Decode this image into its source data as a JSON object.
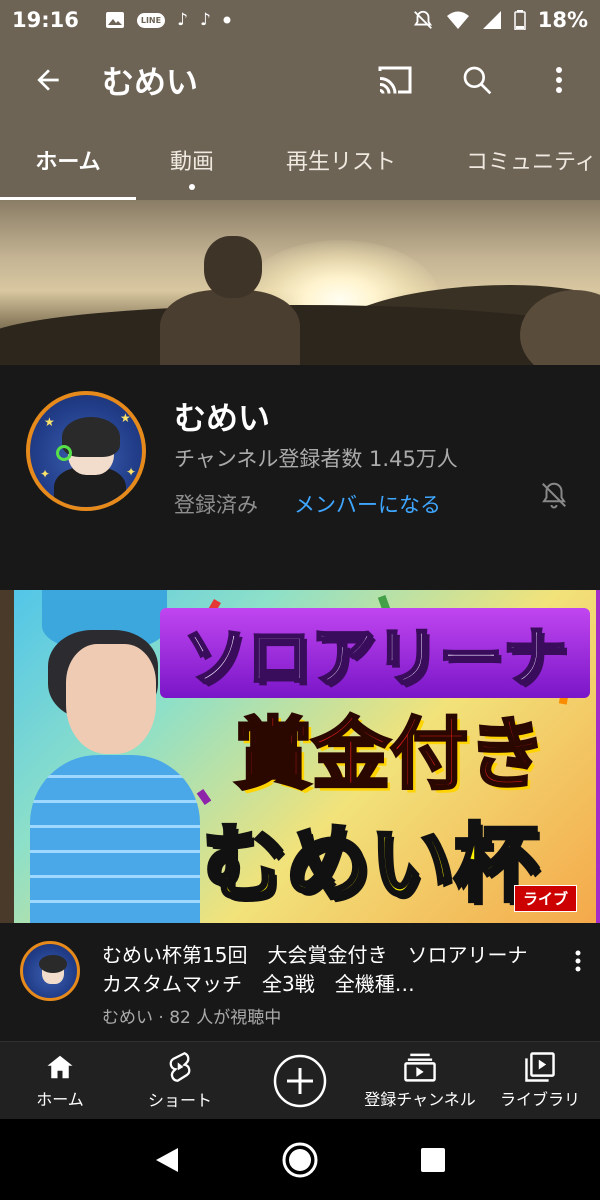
{
  "status_bar": {
    "time": "19:16",
    "line_badge": "LINE",
    "battery_percent": "18%"
  },
  "app_bar": {
    "title": "むめい"
  },
  "tabs": [
    {
      "label": "ホーム"
    },
    {
      "label": "動画"
    },
    {
      "label": "再生リスト"
    },
    {
      "label": "コミュニティ"
    }
  ],
  "channel": {
    "name": "むめい",
    "subscribers": "チャンネル登録者数 1.45万人",
    "subscribed_label": "登録済み",
    "membership_label": "メンバーになる"
  },
  "live_video": {
    "thumb_line1": "ソロアリーナ",
    "thumb_line2": "賞金付き",
    "thumb_line3": "むめい杯",
    "live_badge": "ライブ",
    "title": "むめい杯第15回　大会賞金付き　ソロアリーナカスタムマッチ　全3戦　全機種…",
    "meta": "むめい · 82 人が視聴中"
  },
  "bottom_nav": {
    "items": [
      {
        "label": "ホーム"
      },
      {
        "label": "ショート"
      },
      {
        "label": ""
      },
      {
        "label": "登録チャンネル"
      },
      {
        "label": "ライブラリ"
      }
    ]
  },
  "colors": {
    "header_bg": "#6e6456",
    "link_blue": "#3ea6ff",
    "avatar_ring": "#e68a1c",
    "live_red": "#cc0000"
  }
}
